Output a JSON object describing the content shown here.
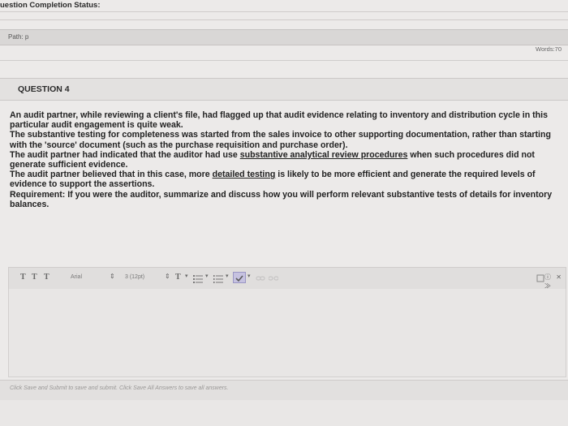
{
  "header": {
    "status_title": "uestion Completion Status:"
  },
  "path_bar": {
    "label": "Path: p",
    "words": "Words:70"
  },
  "question": {
    "title": "QUESTION 4",
    "p1": "An audit partner, while reviewing a client's file, had flagged up that audit evidence relating to inventory and distribution cycle in this particular audit engagement is quite weak.",
    "p2": "The substantive testing for completeness was started from the sales invoice to other supporting documentation, rather than starting with the 'source' document (such as the purchase requisition and purchase order).",
    "p3_a": "The audit partner had indicated that the auditor had use ",
    "p3_u": "substantive analytical review procedures",
    "p3_b": " when such procedures did not generate sufficient evidence.",
    "p4_a": "The audit partner believed that in this case, more ",
    "p4_u": "detailed testing",
    "p4_b": " is likely to be more efficient and generate the required levels of evidence to support the assertions.",
    "p5": "Requirement:   If you were the auditor, summarize and discuss how you will perform relevant substantive tests of details for inventory balances."
  },
  "toolbar": {
    "t1": "T",
    "t2": "T",
    "t3": "T",
    "font_family": "Arial",
    "font_size": "3 (12pt)",
    "text_color": "T",
    "right_icons": "ⓘ ✕ ≫"
  },
  "bottom": {
    "instructions": "Click Save and Submit to save and submit. Click Save All Answers to save all answers."
  }
}
